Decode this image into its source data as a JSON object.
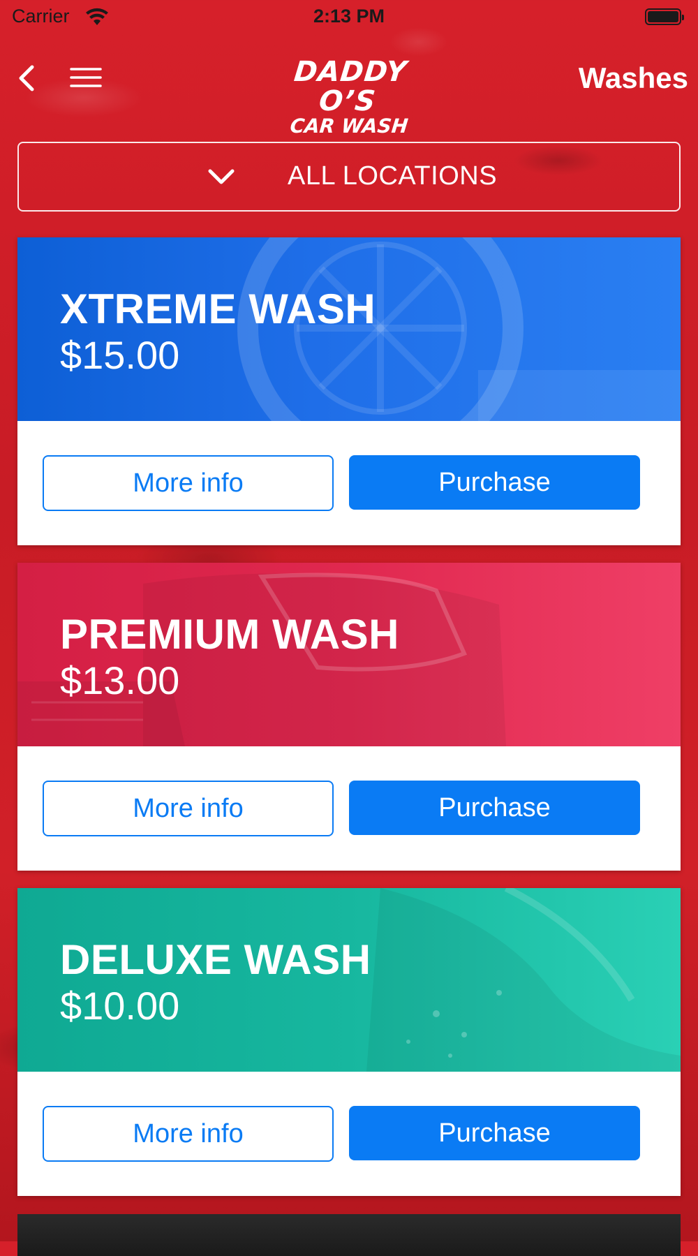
{
  "status_bar": {
    "carrier": "Carrier",
    "time": "2:13 PM",
    "icons": [
      "wifi-icon",
      "battery-icon"
    ]
  },
  "nav": {
    "back_icon": "chevron-left-icon",
    "menu_icon": "hamburger-menu-icon",
    "logo_line1": "DADDY O’S",
    "logo_line2": "CAR WASH",
    "title": "Washes"
  },
  "location_selector": {
    "icon": "chevron-down-icon",
    "label": "ALL LOCATIONS"
  },
  "washes": [
    {
      "name": "XTREME WASH",
      "price": "$15.00",
      "color": "#1f6ee8",
      "more_info_label": "More info",
      "purchase_label": "Purchase"
    },
    {
      "name": "PREMIUM WASH",
      "price": "$13.00",
      "color": "#e0284f",
      "more_info_label": "More info",
      "purchase_label": "Purchase"
    },
    {
      "name": "DELUXE WASH",
      "price": "$10.00",
      "color": "#17b79f",
      "more_info_label": "More info",
      "purchase_label": "Purchase"
    }
  ],
  "colors": {
    "background": "#d1202a",
    "button_blue": "#0a7bf4",
    "card_background": "#ffffff"
  }
}
